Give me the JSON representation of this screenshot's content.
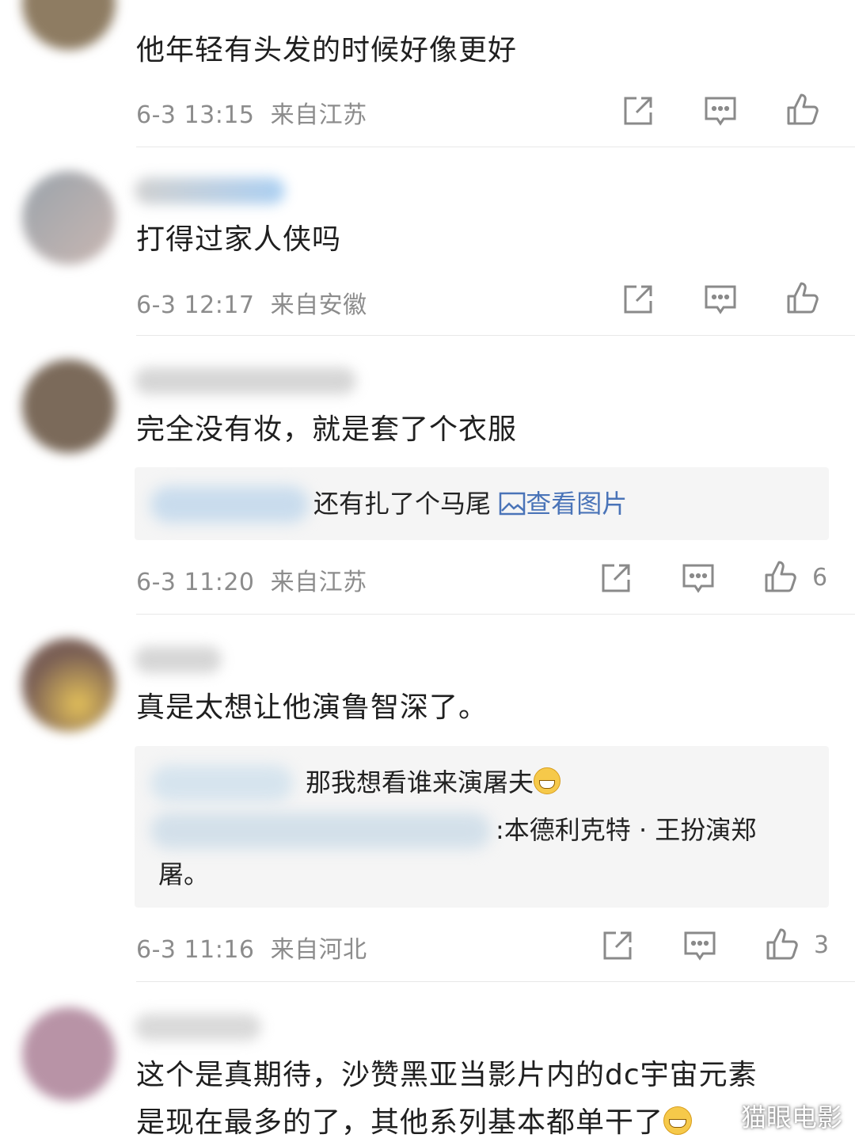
{
  "comments": [
    {
      "text": "他年轻有头发的时候好像更好",
      "time": "6-3 13:15",
      "location": "来自江苏",
      "likes": ""
    },
    {
      "text": "打得过家人侠吗",
      "time": "6-3 12:17",
      "location": "来自安徽",
      "likes": ""
    },
    {
      "text": "完全没有妆，就是套了个衣服",
      "time": "6-3 11:20",
      "location": "来自江苏",
      "likes": "6",
      "reply": {
        "text": "还有扎了个马尾",
        "link": "查看图片"
      }
    },
    {
      "text": "真是太想让他演鲁智深了。",
      "time": "6-3 11:16",
      "location": "来自河北",
      "likes": "3",
      "replies": [
        {
          "text": "那我想看谁来演屠夫"
        },
        {
          "text": ":本德利克特 · 王扮演郑",
          "continuation": "屠。"
        }
      ]
    },
    {
      "text": "这个是真期待，沙赞黑亚当影片内的dc宇宙元素",
      "text_line2": "是现在最多的了，其他系列基本都单干了"
    }
  ],
  "icons": {
    "share": "share-icon",
    "comment": "comment-icon",
    "like": "thumbs-up-icon",
    "picture": "picture-icon",
    "emoji_grin": "grin-emoji",
    "emoji_laugh": "laugh-emoji"
  },
  "watermark": "猫眼电影"
}
